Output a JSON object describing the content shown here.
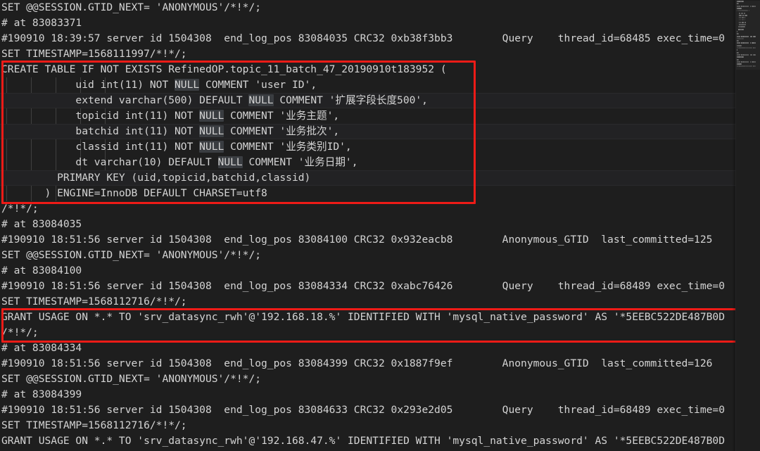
{
  "editor": {
    "theme": "dark",
    "background_color": "#1e1e1e",
    "foreground_color": "#d4d4d4",
    "annotation_color": "#ee1b17",
    "font": "monospace",
    "line_height_px": 22,
    "language": "mysql-binlog"
  },
  "lines": [
    {
      "text": "SET @@SESSION.GTID_NEXT= 'ANONYMOUS'/*!*/;"
    },
    {
      "text": "# at 83083371"
    },
    {
      "text": "#190910 18:39:57 server id 1504308  end_log_pos 83084035 CRC32 0xb38f3bb3        Query    thread_id=68485 exec_time=0"
    },
    {
      "text": "SET TIMESTAMP=1568111997/*!*/;"
    },
    {
      "text": "CREATE TABLE IF NOT EXISTS RefinedOP.topic_11_batch_47_20190910t183952 ("
    },
    {
      "text": "            uid int(11) NOT NULL COMMENT 'user ID',"
    },
    {
      "text": "            extend varchar(500) DEFAULT NULL COMMENT '扩展字段长度500',"
    },
    {
      "text": "            topicid int(11) NOT NULL COMMENT '业务主题',"
    },
    {
      "text": "            batchid int(11) NOT NULL COMMENT '业务批次',"
    },
    {
      "text": "            classid int(11) NOT NULL COMMENT '业务类别ID',"
    },
    {
      "text": "            dt varchar(10) DEFAULT NULL COMMENT '业务日期',"
    },
    {
      "text": "         PRIMARY KEY (uid,topicid,batchid,classid)"
    },
    {
      "text": "       ) ENGINE=InnoDB DEFAULT CHARSET=utf8"
    },
    {
      "text": "/*!*/;"
    },
    {
      "text": "# at 83084035"
    },
    {
      "text": "#190910 18:51:56 server id 1504308  end_log_pos 83084100 CRC32 0x932eacb8        Anonymous_GTID  last_committed=125"
    },
    {
      "text": "SET @@SESSION.GTID_NEXT= 'ANONYMOUS'/*!*/;"
    },
    {
      "text": "# at 83084100"
    },
    {
      "text": "#190910 18:51:56 server id 1504308  end_log_pos 83084334 CRC32 0xabc76426        Query    thread_id=68489 exec_time=0"
    },
    {
      "text": "SET TIMESTAMP=1568112716/*!*/;"
    },
    {
      "text": "GRANT USAGE ON *.* TO 'srv_datasync_rwh'@'192.168.18.%' IDENTIFIED WITH 'mysql_native_password' AS '*5EEBC522DE487B0D"
    },
    {
      "text": "/*!*/;"
    },
    {
      "text": "# at 83084334"
    },
    {
      "text": "#190910 18:51:56 server id 1504308  end_log_pos 83084399 CRC32 0x1887f9ef        Anonymous_GTID  last_committed=126"
    },
    {
      "text": "SET @@SESSION.GTID_NEXT= 'ANONYMOUS'/*!*/;"
    },
    {
      "text": "# at 83084399"
    },
    {
      "text": "#190910 18:51:56 server id 1504308  end_log_pos 83084633 CRC32 0x293e2d05        Query    thread_id=68489 exec_time=0"
    },
    {
      "text": "SET TIMESTAMP=1568112716/*!*/;"
    },
    {
      "text": "GRANT USAGE ON *.* TO 'srv_datasync_rwh'@'192.168.47.%' IDENTIFIED WITH 'mysql_native_password' AS '*5EEBC522DE487B0D"
    }
  ],
  "annotations": [
    {
      "label": "create-table-statement",
      "first_line": 4,
      "last_line": 12
    },
    {
      "label": "grant-usage-statement",
      "first_line": 20,
      "last_line": 21
    }
  ],
  "minimap": {
    "label": "minimap",
    "visible": true
  }
}
